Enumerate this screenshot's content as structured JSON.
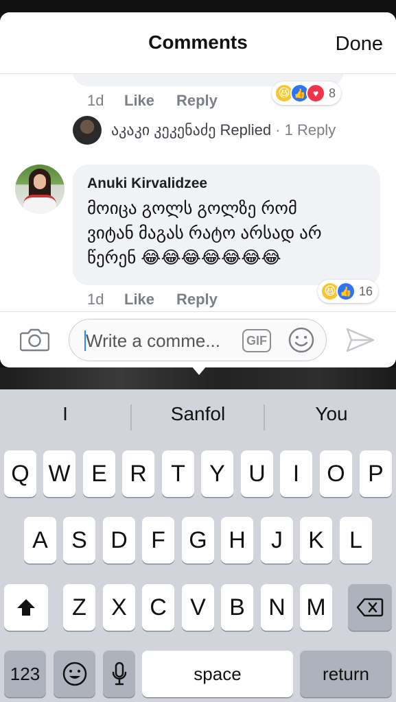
{
  "header": {
    "title": "Comments",
    "done_label": "Done"
  },
  "previous_comment": {
    "time": "1d",
    "like_label": "Like",
    "reply_label": "Reply",
    "reactions": [
      "haha-icon",
      "like-icon",
      "love-icon"
    ],
    "reaction_count": "8"
  },
  "replied_row": {
    "name": "აკაკი კეკენაძე",
    "replied_text": "Replied",
    "replies": "· 1 Reply"
  },
  "comment": {
    "author": "Anuki Kirvalidzee",
    "lines": [
      "მოიცა გოლს გოლზე რომ",
      "ვიტან მაგას რატო არსად არ",
      "წერენ 😂😂😂😂😂😂😂"
    ],
    "time": "1d",
    "like_label": "Like",
    "reply_label": "Reply",
    "reactions": [
      "haha-icon",
      "like-icon"
    ],
    "reaction_count": "16"
  },
  "composer": {
    "placeholder": "Write a comme...",
    "gif_label": "GIF"
  },
  "keyboard": {
    "suggestions": [
      "I",
      "Sanfol",
      "You"
    ],
    "row1": [
      "Q",
      "W",
      "E",
      "R",
      "T",
      "Y",
      "U",
      "I",
      "O",
      "P"
    ],
    "row2": [
      "A",
      "S",
      "D",
      "F",
      "G",
      "H",
      "J",
      "K",
      "L"
    ],
    "row3": [
      "Z",
      "X",
      "C",
      "V",
      "B",
      "N",
      "M"
    ],
    "numbers_label": "123",
    "space_label": "space",
    "return_label": "return"
  },
  "colors": {
    "accent": "#2d88ff",
    "like_blue": "#2b74f5",
    "love_red": "#f0334a",
    "haha_yellow": "#f7c62f"
  }
}
